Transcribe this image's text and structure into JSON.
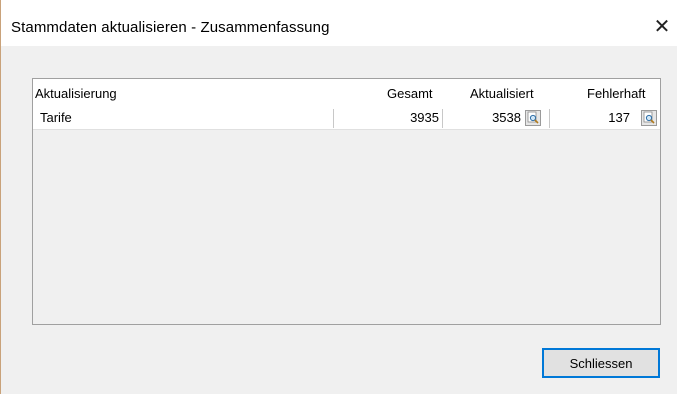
{
  "window": {
    "title": "Stammdaten aktualisieren - Zusammenfassung",
    "close_glyph": "✕"
  },
  "table": {
    "columns": [
      "Aktualisierung",
      "Gesamt",
      "Aktualisiert",
      "Fehlerhaft"
    ],
    "rows": [
      {
        "name": "Tarife",
        "gesamt": "3935",
        "aktualisiert": "3538",
        "fehlerhaft": "137"
      }
    ]
  },
  "buttons": {
    "close_label": "Schliessen"
  },
  "icons": {
    "row_detail": "magnifier-icon"
  }
}
